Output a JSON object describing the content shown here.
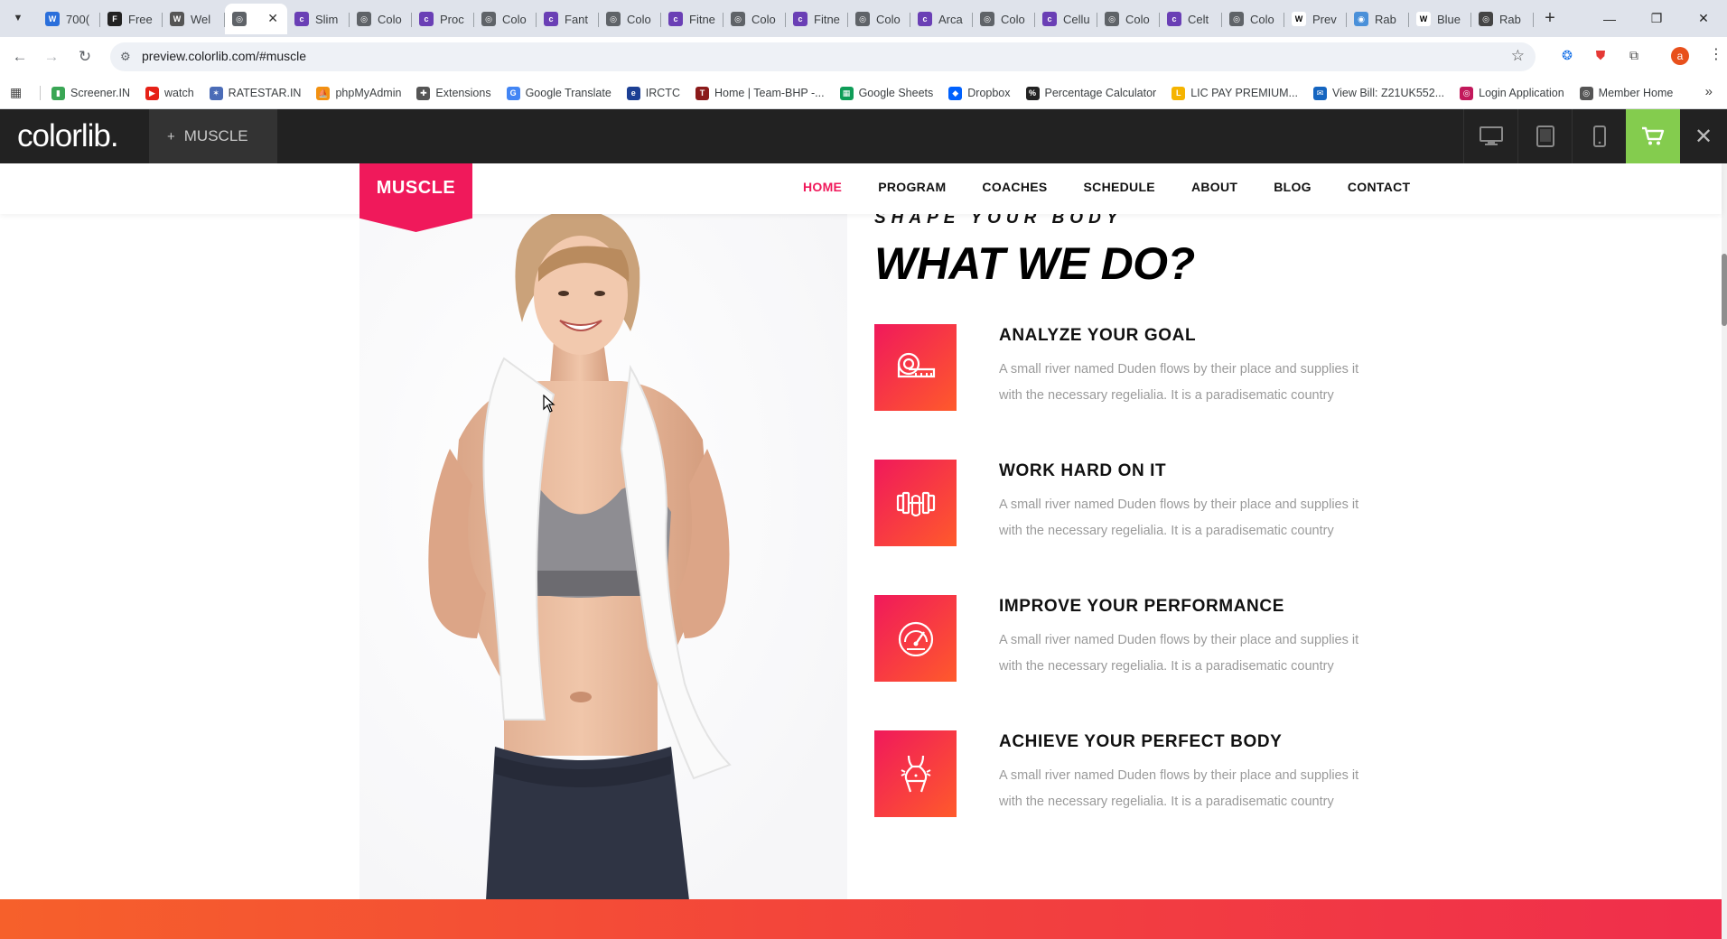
{
  "browser": {
    "tabs": [
      {
        "title": "700(",
        "fav_color": "#2a6fdb",
        "fav_glyph": "W"
      },
      {
        "title": "Free",
        "fav_color": "#222222",
        "fav_glyph": "F"
      },
      {
        "title": "Wel",
        "fav_color": "#555555",
        "fav_glyph": "W"
      },
      {
        "title": "",
        "fav_color": "#5f6368",
        "fav_glyph": "◎",
        "active": true
      },
      {
        "title": "Slim",
        "fav_color": "#6a3fb5",
        "fav_glyph": "c"
      },
      {
        "title": "Colo",
        "fav_color": "#5f6368",
        "fav_glyph": "◎"
      },
      {
        "title": "Proc",
        "fav_color": "#6a3fb5",
        "fav_glyph": "c"
      },
      {
        "title": "Colo",
        "fav_color": "#5f6368",
        "fav_glyph": "◎"
      },
      {
        "title": "Fant",
        "fav_color": "#6a3fb5",
        "fav_glyph": "c"
      },
      {
        "title": "Colo",
        "fav_color": "#5f6368",
        "fav_glyph": "◎"
      },
      {
        "title": "Fitne",
        "fav_color": "#6a3fb5",
        "fav_glyph": "c"
      },
      {
        "title": "Colo",
        "fav_color": "#5f6368",
        "fav_glyph": "◎"
      },
      {
        "title": "Fitne",
        "fav_color": "#6a3fb5",
        "fav_glyph": "c"
      },
      {
        "title": "Colo",
        "fav_color": "#5f6368",
        "fav_glyph": "◎"
      },
      {
        "title": "Arca",
        "fav_color": "#6a3fb5",
        "fav_glyph": "c"
      },
      {
        "title": "Colo",
        "fav_color": "#5f6368",
        "fav_glyph": "◎"
      },
      {
        "title": "Cellu",
        "fav_color": "#6a3fb5",
        "fav_glyph": "c"
      },
      {
        "title": "Colo",
        "fav_color": "#5f6368",
        "fav_glyph": "◎"
      },
      {
        "title": "Celt",
        "fav_color": "#6a3fb5",
        "fav_glyph": "c"
      },
      {
        "title": "Colo",
        "fav_color": "#5f6368",
        "fav_glyph": "◎"
      },
      {
        "title": "Prev",
        "fav_color": "#ffffff",
        "fav_glyph": "W"
      },
      {
        "title": "Rab",
        "fav_color": "#4a90d9",
        "fav_glyph": "◉"
      },
      {
        "title": "Blue",
        "fav_color": "#ffffff",
        "fav_glyph": "W"
      },
      {
        "title": "Rab",
        "fav_color": "#444444",
        "fav_glyph": "◎"
      }
    ],
    "url": "preview.colorlib.com/#muscle",
    "bookmarks": [
      {
        "label": "Screener.IN",
        "color": "#3aa655",
        "glyph": "▮"
      },
      {
        "label": "watch",
        "color": "#e62117",
        "glyph": "▶"
      },
      {
        "label": "RATESTAR.IN",
        "color": "#4b6cb7",
        "glyph": "✶"
      },
      {
        "label": "phpMyAdmin",
        "color": "#f29111",
        "glyph": "⛵"
      },
      {
        "label": "Extensions",
        "color": "#555555",
        "glyph": "✚"
      },
      {
        "label": "Google Translate",
        "color": "#4285f4",
        "glyph": "G"
      },
      {
        "label": "IRCTC",
        "color": "#1c3f94",
        "glyph": "e"
      },
      {
        "label": "Home | Team-BHP -...",
        "color": "#8b1a1a",
        "glyph": "T"
      },
      {
        "label": "Google Sheets",
        "color": "#0f9d58",
        "glyph": "▦"
      },
      {
        "label": "Dropbox",
        "color": "#0061fe",
        "glyph": "◆"
      },
      {
        "label": "Percentage Calculator",
        "color": "#222222",
        "glyph": "%"
      },
      {
        "label": "LIC PAY PREMIUM...",
        "color": "#f5b400",
        "glyph": "L"
      },
      {
        "label": "View Bill: Z21UK552...",
        "color": "#1565c0",
        "glyph": "✉"
      },
      {
        "label": "Login Application",
        "color": "#c2185b",
        "glyph": "◎"
      },
      {
        "label": "Member Home",
        "color": "#555555",
        "glyph": "◎"
      }
    ]
  },
  "colorlib": {
    "logo": "colorlib.",
    "theme_label": "MUSCLE",
    "accent": "#84cc4e"
  },
  "site": {
    "brand": "MUSCLE",
    "brand_color": "#f0195b",
    "menu": [
      {
        "label": "HOME",
        "active": true
      },
      {
        "label": "PROGRAM"
      },
      {
        "label": "COACHES"
      },
      {
        "label": "SCHEDULE"
      },
      {
        "label": "ABOUT"
      },
      {
        "label": "BLOG"
      },
      {
        "label": "CONTACT"
      }
    ],
    "section": {
      "subtitle": "SHAPE YOUR BODY",
      "title": "WHAT WE DO?",
      "services": [
        {
          "icon": "measuring-tape-icon",
          "title": "ANALYZE YOUR GOAL",
          "text": "A small river named Duden flows by their place and supplies it with the necessary regelialia. It is a paradisematic country"
        },
        {
          "icon": "dumbbell-icon",
          "title": "WORK HARD ON IT",
          "text": "A small river named Duden flows by their place and supplies it with the necessary regelialia. It is a paradisematic country"
        },
        {
          "icon": "speedometer-icon",
          "title": "IMPROVE YOUR PERFORMANCE",
          "text": "A small river named Duden flows by their place and supplies it with the necessary regelialia. It is a paradisematic country"
        },
        {
          "icon": "body-shape-icon",
          "title": "ACHIEVE YOUR PERFECT BODY",
          "text": "A small river named Duden flows by their place and supplies it with the necessary regelialia. It is a paradisematic country"
        }
      ]
    }
  }
}
